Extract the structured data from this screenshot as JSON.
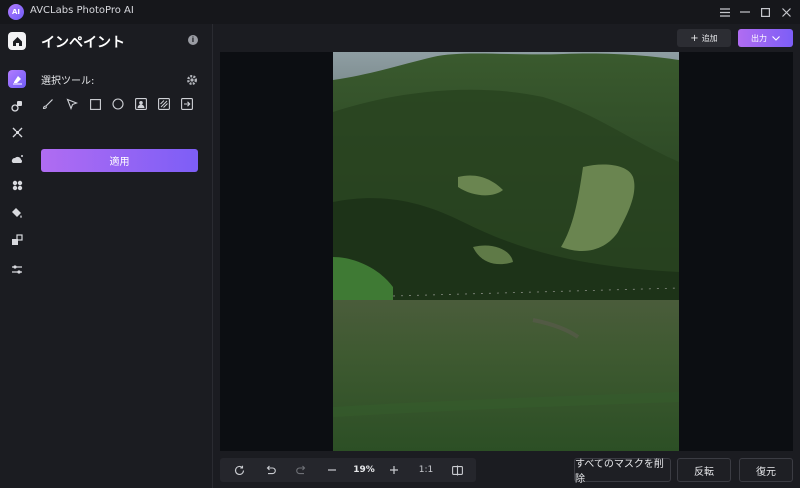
{
  "window": {
    "app_title": "AVCLabs PhotoPro AI",
    "logo_text": "AI",
    "controls": [
      "menu-icon",
      "minimize-icon",
      "maximize-icon",
      "close-icon"
    ]
  },
  "rail": {
    "items": [
      "home-icon",
      "inpaint-icon",
      "object-remove-icon",
      "expand-icon",
      "sky-replace-icon",
      "enhance-icon",
      "colorize-icon",
      "background-icon",
      "adjust-icon"
    ],
    "active": "inpaint-icon"
  },
  "panel": {
    "title": "インペイント",
    "tool_label": "選択ツール:",
    "tools": [
      "brush-icon",
      "pointer-icon",
      "rectangle-icon",
      "ellipse-icon",
      "portrait-select-icon",
      "hatch-select-icon",
      "import-mask-icon"
    ],
    "apply_label": "適用"
  },
  "header": {
    "add_label": "追加",
    "export_label": "出力"
  },
  "zoom": {
    "level": "19%",
    "ratio": "1:1"
  },
  "actions": {
    "clear_masks": "すべてのマスクを削除",
    "invert": "反転",
    "restore": "復元"
  },
  "colors": {
    "accent_start": "#b06cf2",
    "accent_end": "#7d5ef6",
    "background": "#1b1c21",
    "canvas": "#0c0e12"
  }
}
